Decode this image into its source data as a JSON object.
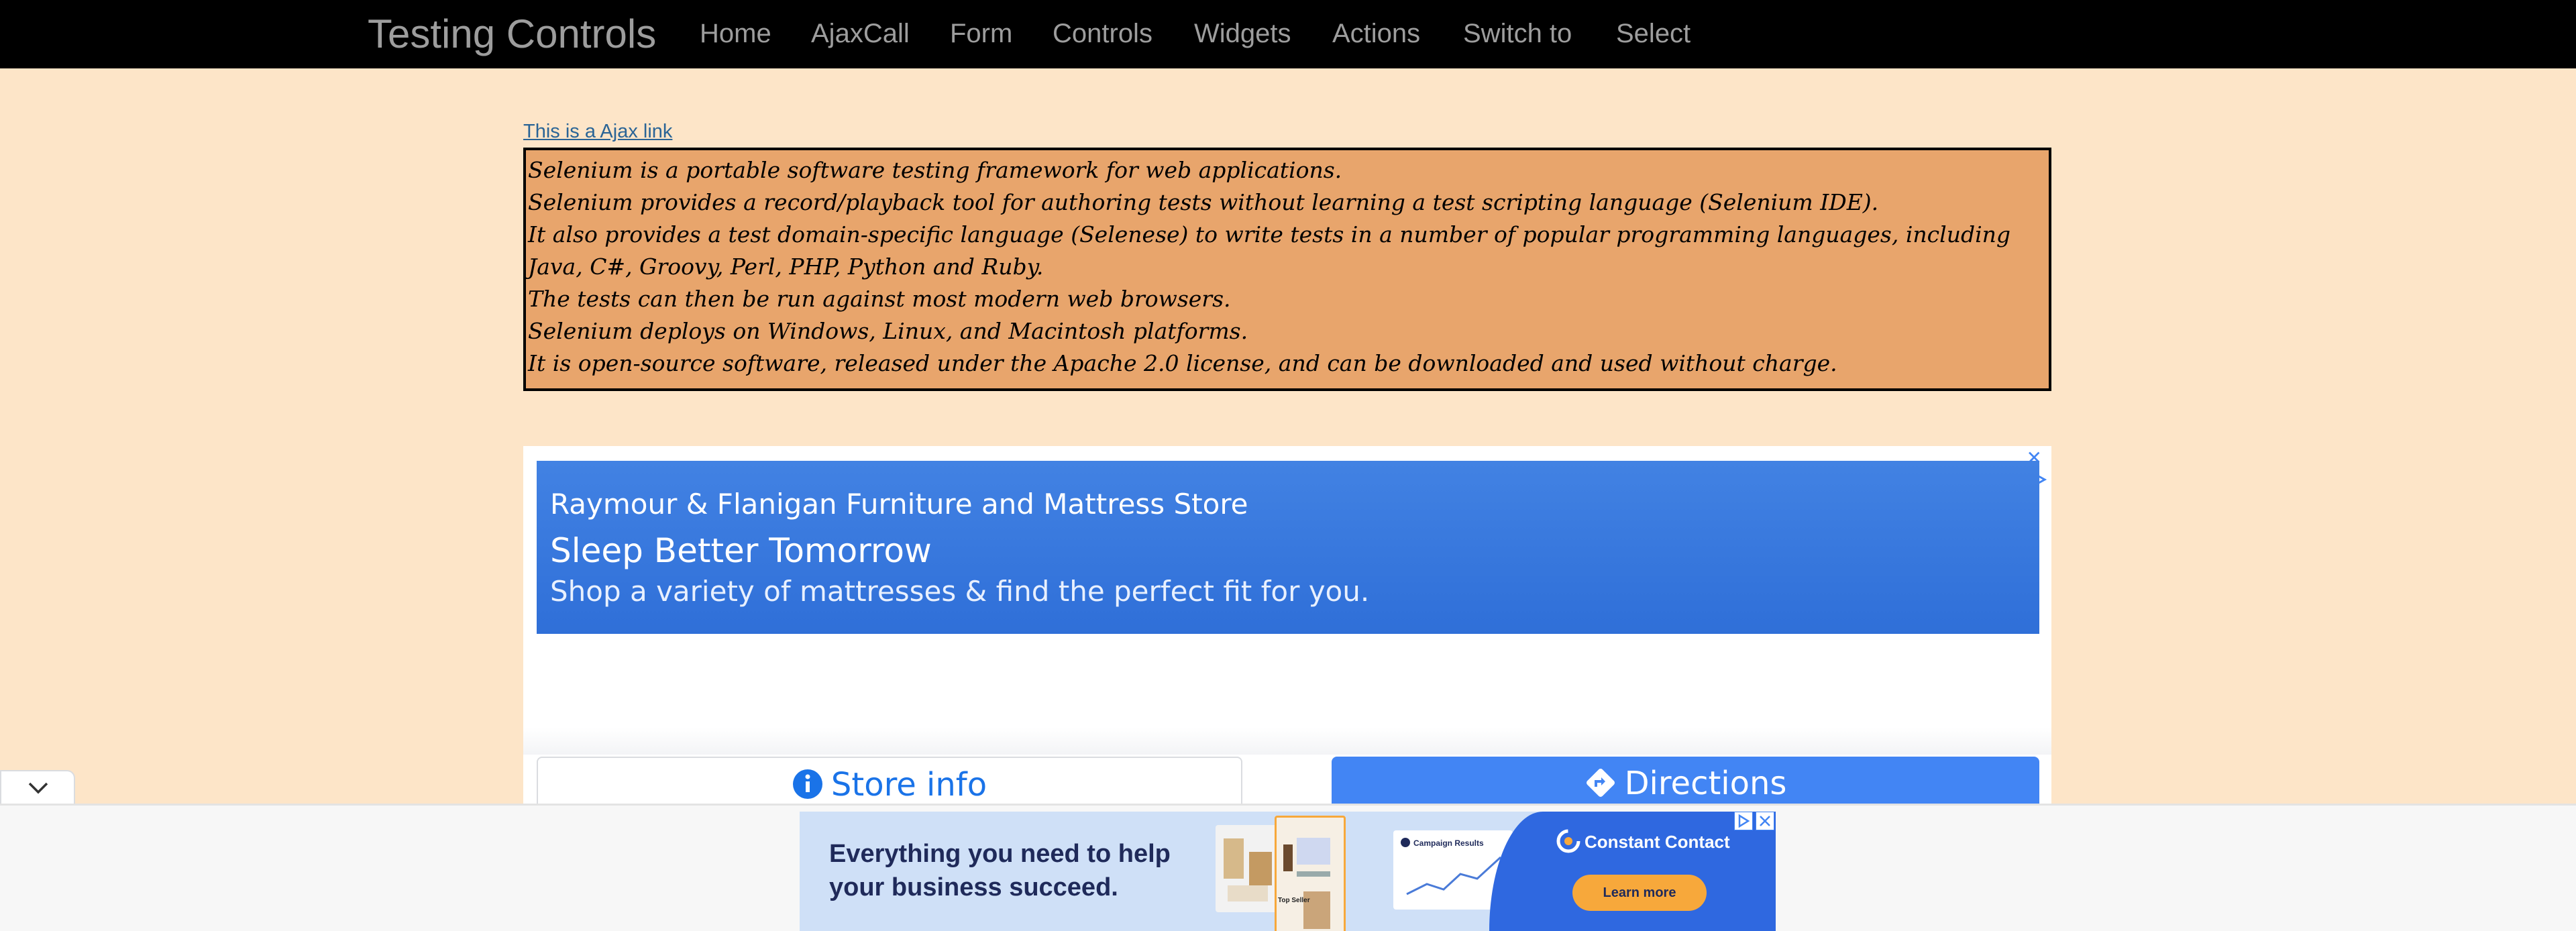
{
  "navbar": {
    "brand": "Testing Controls",
    "items": [
      {
        "label": "Home"
      },
      {
        "label": "AjaxCall"
      },
      {
        "label": "Form"
      },
      {
        "label": "Controls"
      },
      {
        "label": "Widgets"
      },
      {
        "label": "Actions"
      },
      {
        "label": "Switch to"
      },
      {
        "label": "Select"
      }
    ]
  },
  "content": {
    "ajax_link": "This is a Ajax link",
    "paragraphs": [
      "Selenium is a portable software testing framework for web applications.",
      "Selenium provides a record/playback tool for authoring tests without learning a test scripting language (Selenium IDE).",
      "It also provides a test domain-specific language (Selenese) to write tests in a number of popular programming languages, including Java, C#, Groovy, Perl, PHP, Python and Ruby.",
      "The tests can then be run against most modern web browsers.",
      "Selenium deploys on Windows, Linux, and Macintosh platforms.",
      "It is open-source software, released under the Apache 2.0 license, and can be downloaded and used without charge."
    ]
  },
  "ad": {
    "advertiser": "Raymour & Flanigan Furniture and Mattress Store",
    "headline": "Sleep Better Tomorrow",
    "description": "Shop a variety of mattresses & find the perfect fit for you.",
    "store_info_label": "Store info",
    "directions_label": "Directions"
  },
  "banner": {
    "headline": "Everything you need to help your business succeed.",
    "brand": "Constant Contact",
    "cta": "Learn more",
    "campaign_label": "Campaign Results",
    "top_seller_label": "Top Seller"
  },
  "colors": {
    "page_bg": "#fde5c8",
    "navbar_bg": "#000000",
    "nav_text": "#9d9d9d",
    "text_box_bg": "#e8a56c",
    "ad_blue": "#4285f4",
    "banner_cta": "#f7a83b"
  }
}
